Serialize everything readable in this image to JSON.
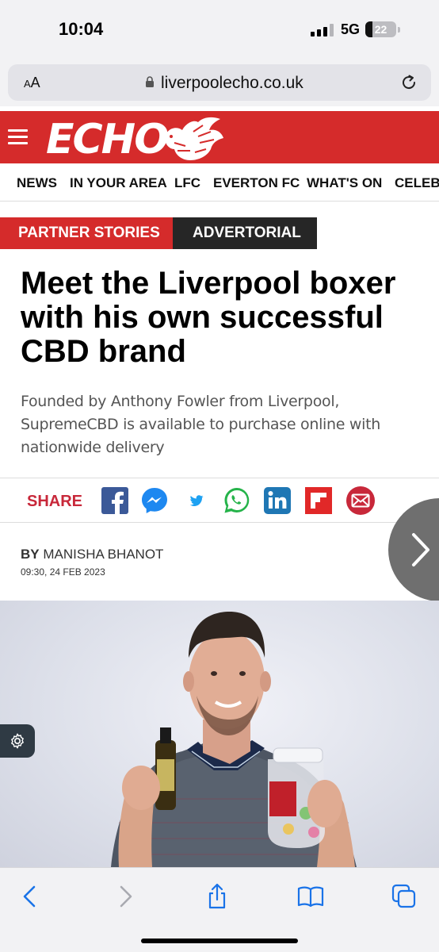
{
  "status_bar": {
    "time": "10:04",
    "network": "5G",
    "battery": "22",
    "battery_level": 0.22
  },
  "browser": {
    "text_size_label_small": "A",
    "text_size_label_large": "A",
    "url": "liverpoolecho.co.uk"
  },
  "site": {
    "logo_text": "ECHO",
    "nav_items": [
      "NEWS",
      "IN YOUR AREA",
      "LFC",
      "EVERTON FC",
      "WHAT'S ON",
      "CELEBS"
    ]
  },
  "article": {
    "tag_primary": "PARTNER STORIES",
    "tag_secondary": "ADVERTORIAL",
    "headline": "Meet the Liverpool boxer with his own successful CBD brand",
    "standfirst": "Founded by Anthony Fowler from Liverpool, SupremeCBD is available to purchase online with nationwide delivery",
    "share_label": "SHARE",
    "byline_prefix": "BY",
    "author": "MANISHA BHANOT",
    "timestamp": "09:30, 24 FEB 2023"
  },
  "share_icons": [
    "facebook-icon",
    "messenger-icon",
    "twitter-icon",
    "whatsapp-icon",
    "linkedin-icon",
    "flipboard-icon",
    "email-icon"
  ],
  "colors": {
    "brand_red": "#d52b2b",
    "share_red": "#c8283a",
    "advertorial_dark": "#262626",
    "ui_blue": "#1a73e8"
  }
}
